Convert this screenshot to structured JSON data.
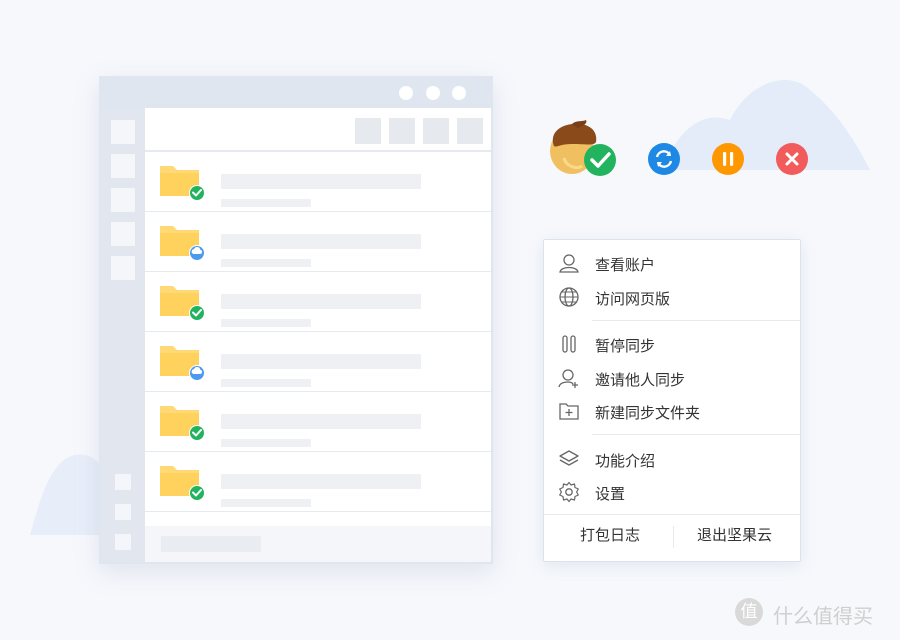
{
  "menu": {
    "items": [
      {
        "label": "查看账户",
        "icon": "user-icon"
      },
      {
        "label": "访问网页版",
        "icon": "globe-icon"
      },
      {
        "label": "暂停同步",
        "icon": "pause-icon"
      },
      {
        "label": "邀请他人同步",
        "icon": "invite-user-icon"
      },
      {
        "label": "新建同步文件夹",
        "icon": "new-folder-icon"
      },
      {
        "label": "功能介绍",
        "icon": "layers-icon"
      },
      {
        "label": "设置",
        "icon": "gear-icon"
      }
    ],
    "footer": {
      "left": "打包日志",
      "right": "退出坚果云"
    }
  },
  "folders": [
    {
      "status": "synced"
    },
    {
      "status": "cloud"
    },
    {
      "status": "synced"
    },
    {
      "status": "cloud"
    },
    {
      "status": "synced"
    },
    {
      "status": "synced"
    }
  ],
  "status_icons": [
    "synced",
    "syncing",
    "paused",
    "error"
  ],
  "colors": {
    "synced": "#22b35e",
    "cloud": "#4a9bf0",
    "syncing": "#1e88e5",
    "paused": "#ff9800",
    "error": "#f25b5b",
    "folder": "#ffd25e"
  },
  "watermark": {
    "logo_glyph": "值",
    "text": "什么值得买"
  }
}
